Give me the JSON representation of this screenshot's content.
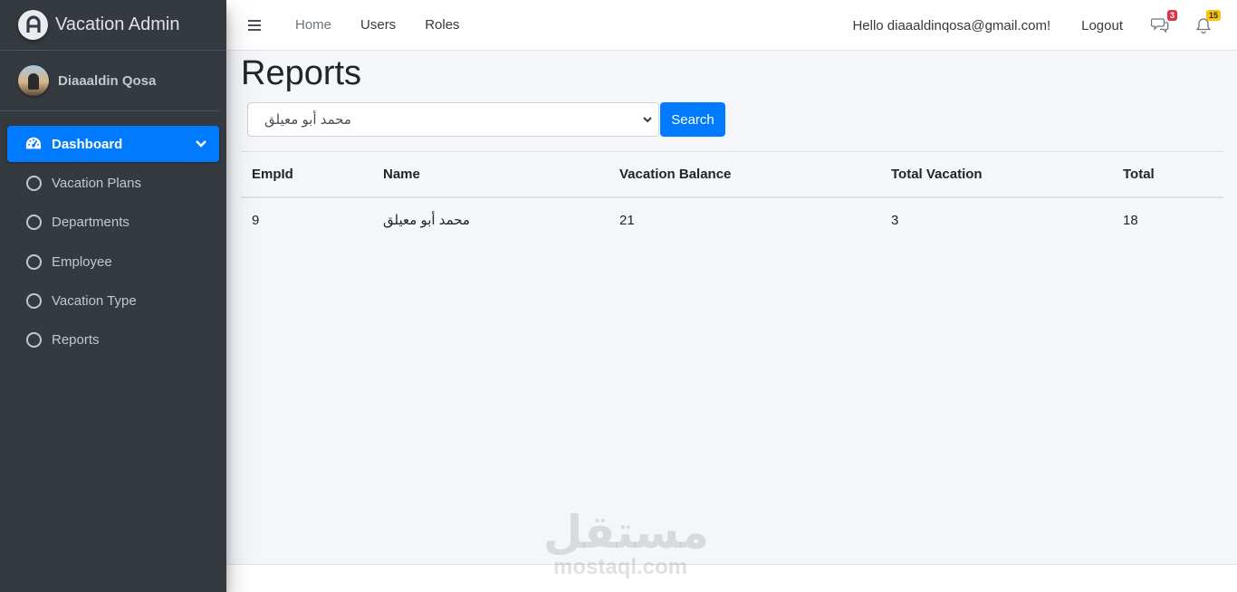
{
  "brand": {
    "title": "Vacation Admin"
  },
  "user": {
    "name": "Diaaaldin Qosa"
  },
  "sidebar": {
    "items": [
      {
        "label": "Dashboard",
        "icon": "dashboard-icon",
        "active": true
      },
      {
        "label": "Vacation Plans",
        "icon": "circle-icon"
      },
      {
        "label": "Departments",
        "icon": "circle-icon"
      },
      {
        "label": "Employee",
        "icon": "circle-icon"
      },
      {
        "label": "Vacation Type",
        "icon": "circle-icon"
      },
      {
        "label": "Reports",
        "icon": "circle-icon"
      }
    ]
  },
  "topbar": {
    "links": [
      "Home",
      "Users",
      "Roles"
    ],
    "greeting": "Hello diaaaldinqosa@gmail.com!",
    "logout": "Logout",
    "messages_count": "3",
    "notifications_count": "15"
  },
  "page": {
    "title": "Reports",
    "employee_select_value": "محمد أبو معيلق",
    "search_label": "Search"
  },
  "table": {
    "headers": [
      "EmpId",
      "Name",
      "Vacation Balance",
      "Total Vacation",
      "Total"
    ],
    "rows": [
      [
        "9",
        "محمد أبو معيلق",
        "21",
        "3",
        "18"
      ]
    ]
  },
  "watermark": {
    "arabic": "مستقل",
    "latin": "mostaql.com"
  },
  "colors": {
    "sidebar": "#343a40",
    "accent": "#007bff",
    "content_bg": "#f4f6f9"
  }
}
